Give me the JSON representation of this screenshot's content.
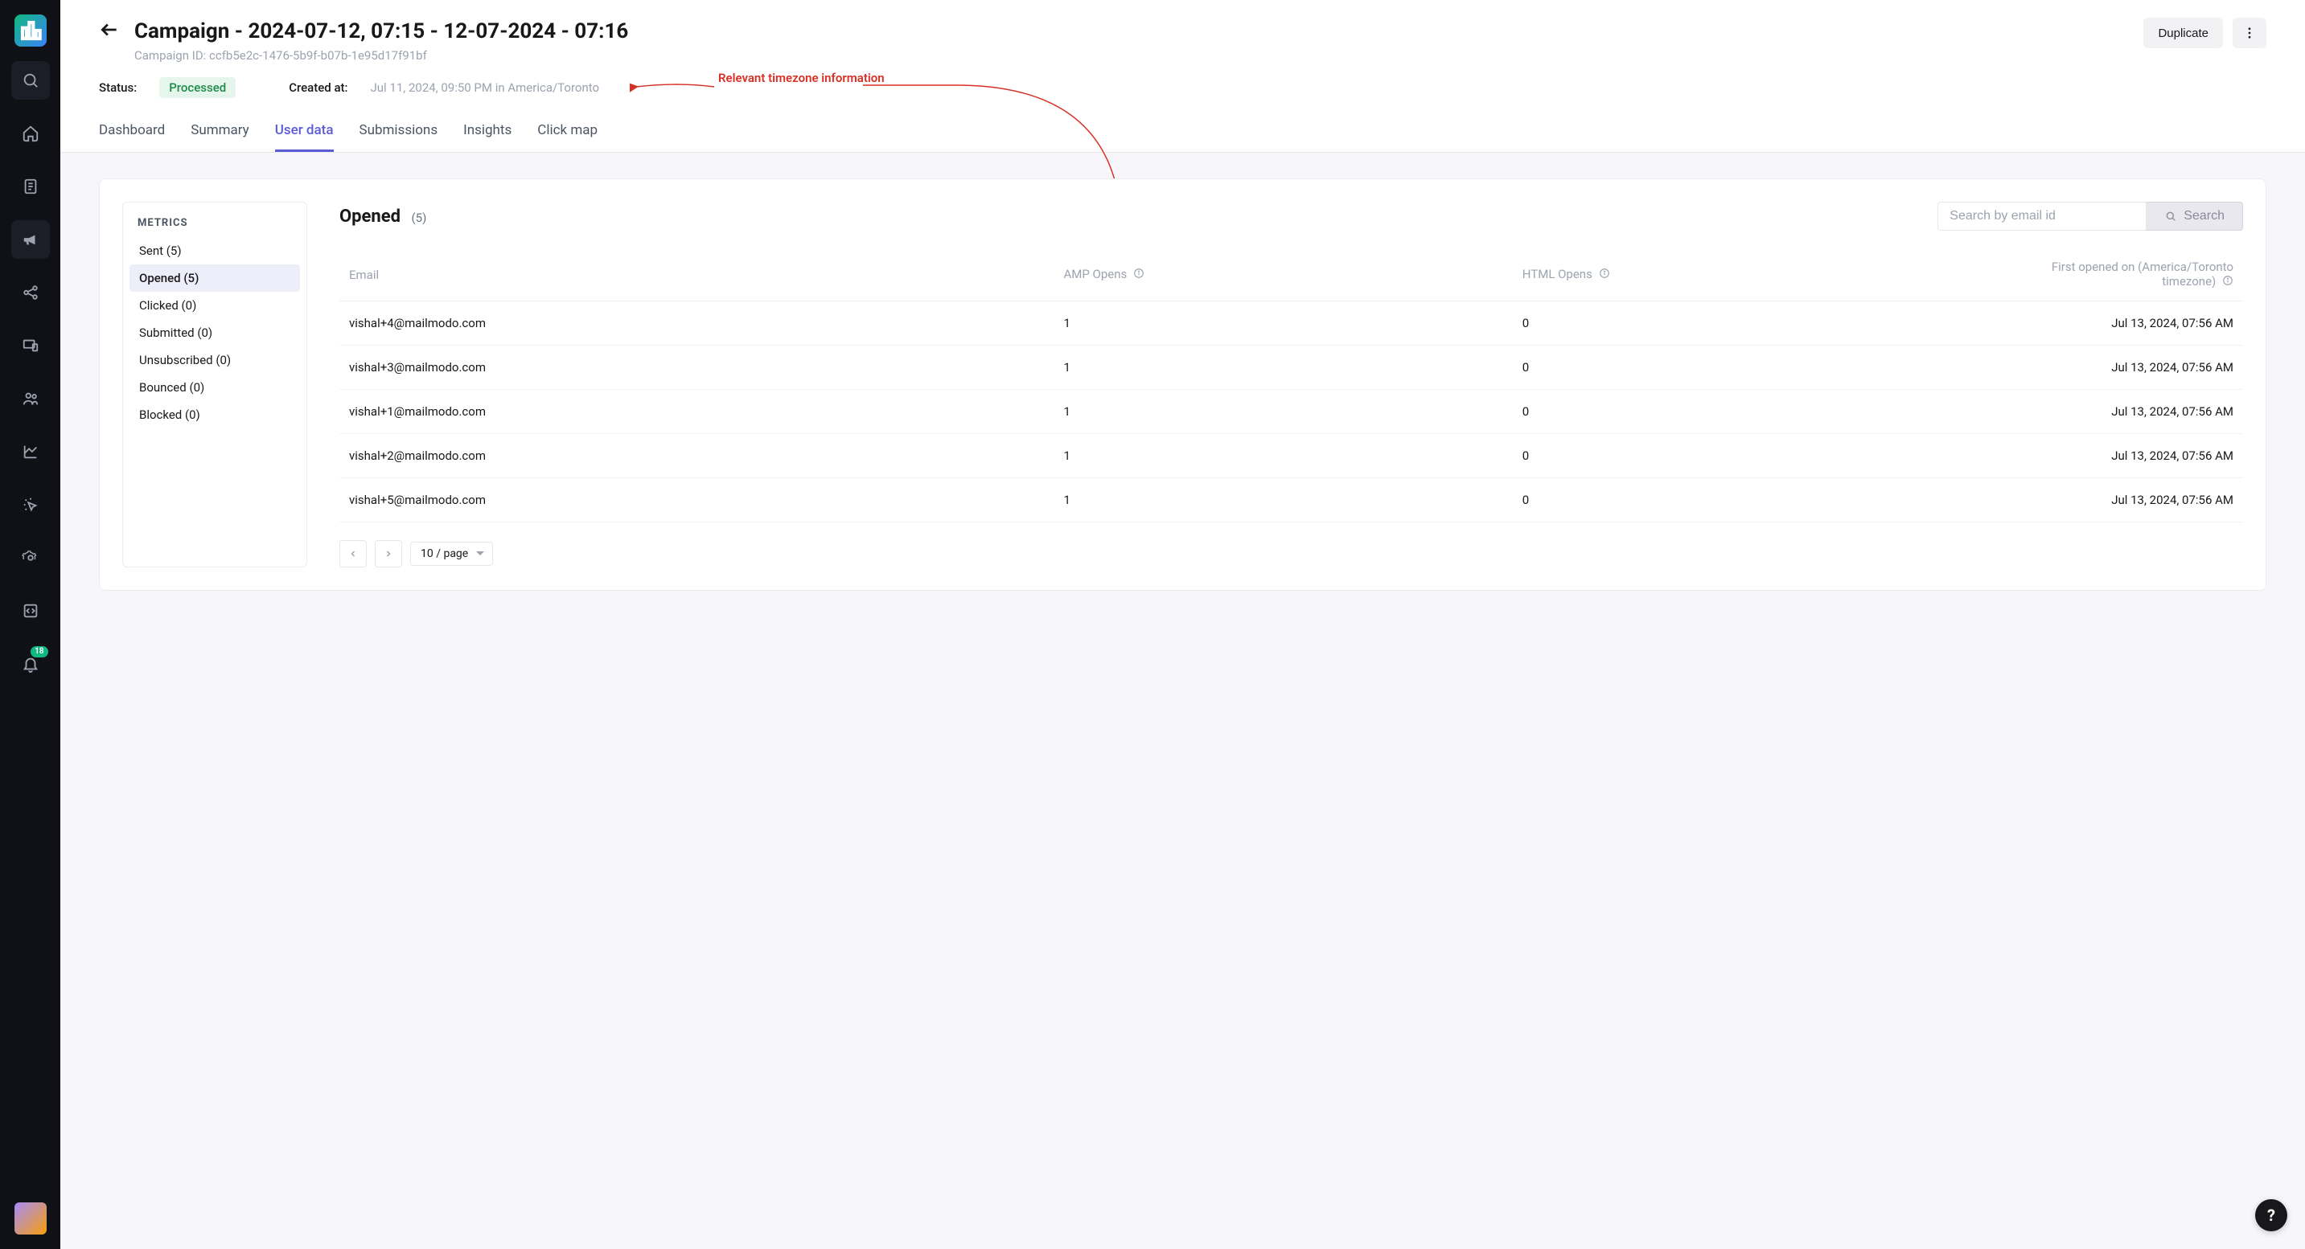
{
  "header": {
    "title": "Campaign - 2024-07-12, 07:15 - 12-07-2024 - 07:16",
    "campaign_id_label": "Campaign ID: ccfb5e2c-1476-5b9f-b07b-1e95d17f91bf",
    "duplicate_label": "Duplicate"
  },
  "meta": {
    "status_label": "Status:",
    "status_value": "Processed",
    "created_label": "Created at:",
    "created_value": "Jul 11, 2024, 09:50 PM in America/Toronto"
  },
  "annotation": {
    "text": "Relevant timezone information"
  },
  "tabs": [
    {
      "label": "Dashboard",
      "active": false
    },
    {
      "label": "Summary",
      "active": false
    },
    {
      "label": "User data",
      "active": true
    },
    {
      "label": "Submissions",
      "active": false
    },
    {
      "label": "Insights",
      "active": false
    },
    {
      "label": "Click map",
      "active": false
    }
  ],
  "metrics": {
    "heading": "METRICS",
    "items": [
      {
        "label": "Sent (5)",
        "active": false
      },
      {
        "label": "Opened (5)",
        "active": true
      },
      {
        "label": "Clicked (0)",
        "active": false
      },
      {
        "label": "Submitted (0)",
        "active": false
      },
      {
        "label": "Unsubscribed (0)",
        "active": false
      },
      {
        "label": "Bounced (0)",
        "active": false
      },
      {
        "label": "Blocked (0)",
        "active": false
      }
    ]
  },
  "table": {
    "title": "Opened",
    "count": "(5)",
    "search_placeholder": "Search by email id",
    "search_button": "Search",
    "columns": {
      "email": "Email",
      "amp": "AMP Opens",
      "html": "HTML Opens",
      "first": "First opened on (America/Toronto timezone)"
    },
    "rows": [
      {
        "email": "vishal+4@mailmodo.com",
        "amp": "1",
        "html": "0",
        "first": "Jul 13, 2024, 07:56 AM"
      },
      {
        "email": "vishal+3@mailmodo.com",
        "amp": "1",
        "html": "0",
        "first": "Jul 13, 2024, 07:56 AM"
      },
      {
        "email": "vishal+1@mailmodo.com",
        "amp": "1",
        "html": "0",
        "first": "Jul 13, 2024, 07:56 AM"
      },
      {
        "email": "vishal+2@mailmodo.com",
        "amp": "1",
        "html": "0",
        "first": "Jul 13, 2024, 07:56 AM"
      },
      {
        "email": "vishal+5@mailmodo.com",
        "amp": "1",
        "html": "0",
        "first": "Jul 13, 2024, 07:56 AM"
      }
    ],
    "page_size": "10 / page"
  },
  "rail": {
    "notifications_badge": "18"
  },
  "help": {
    "label": "?"
  }
}
